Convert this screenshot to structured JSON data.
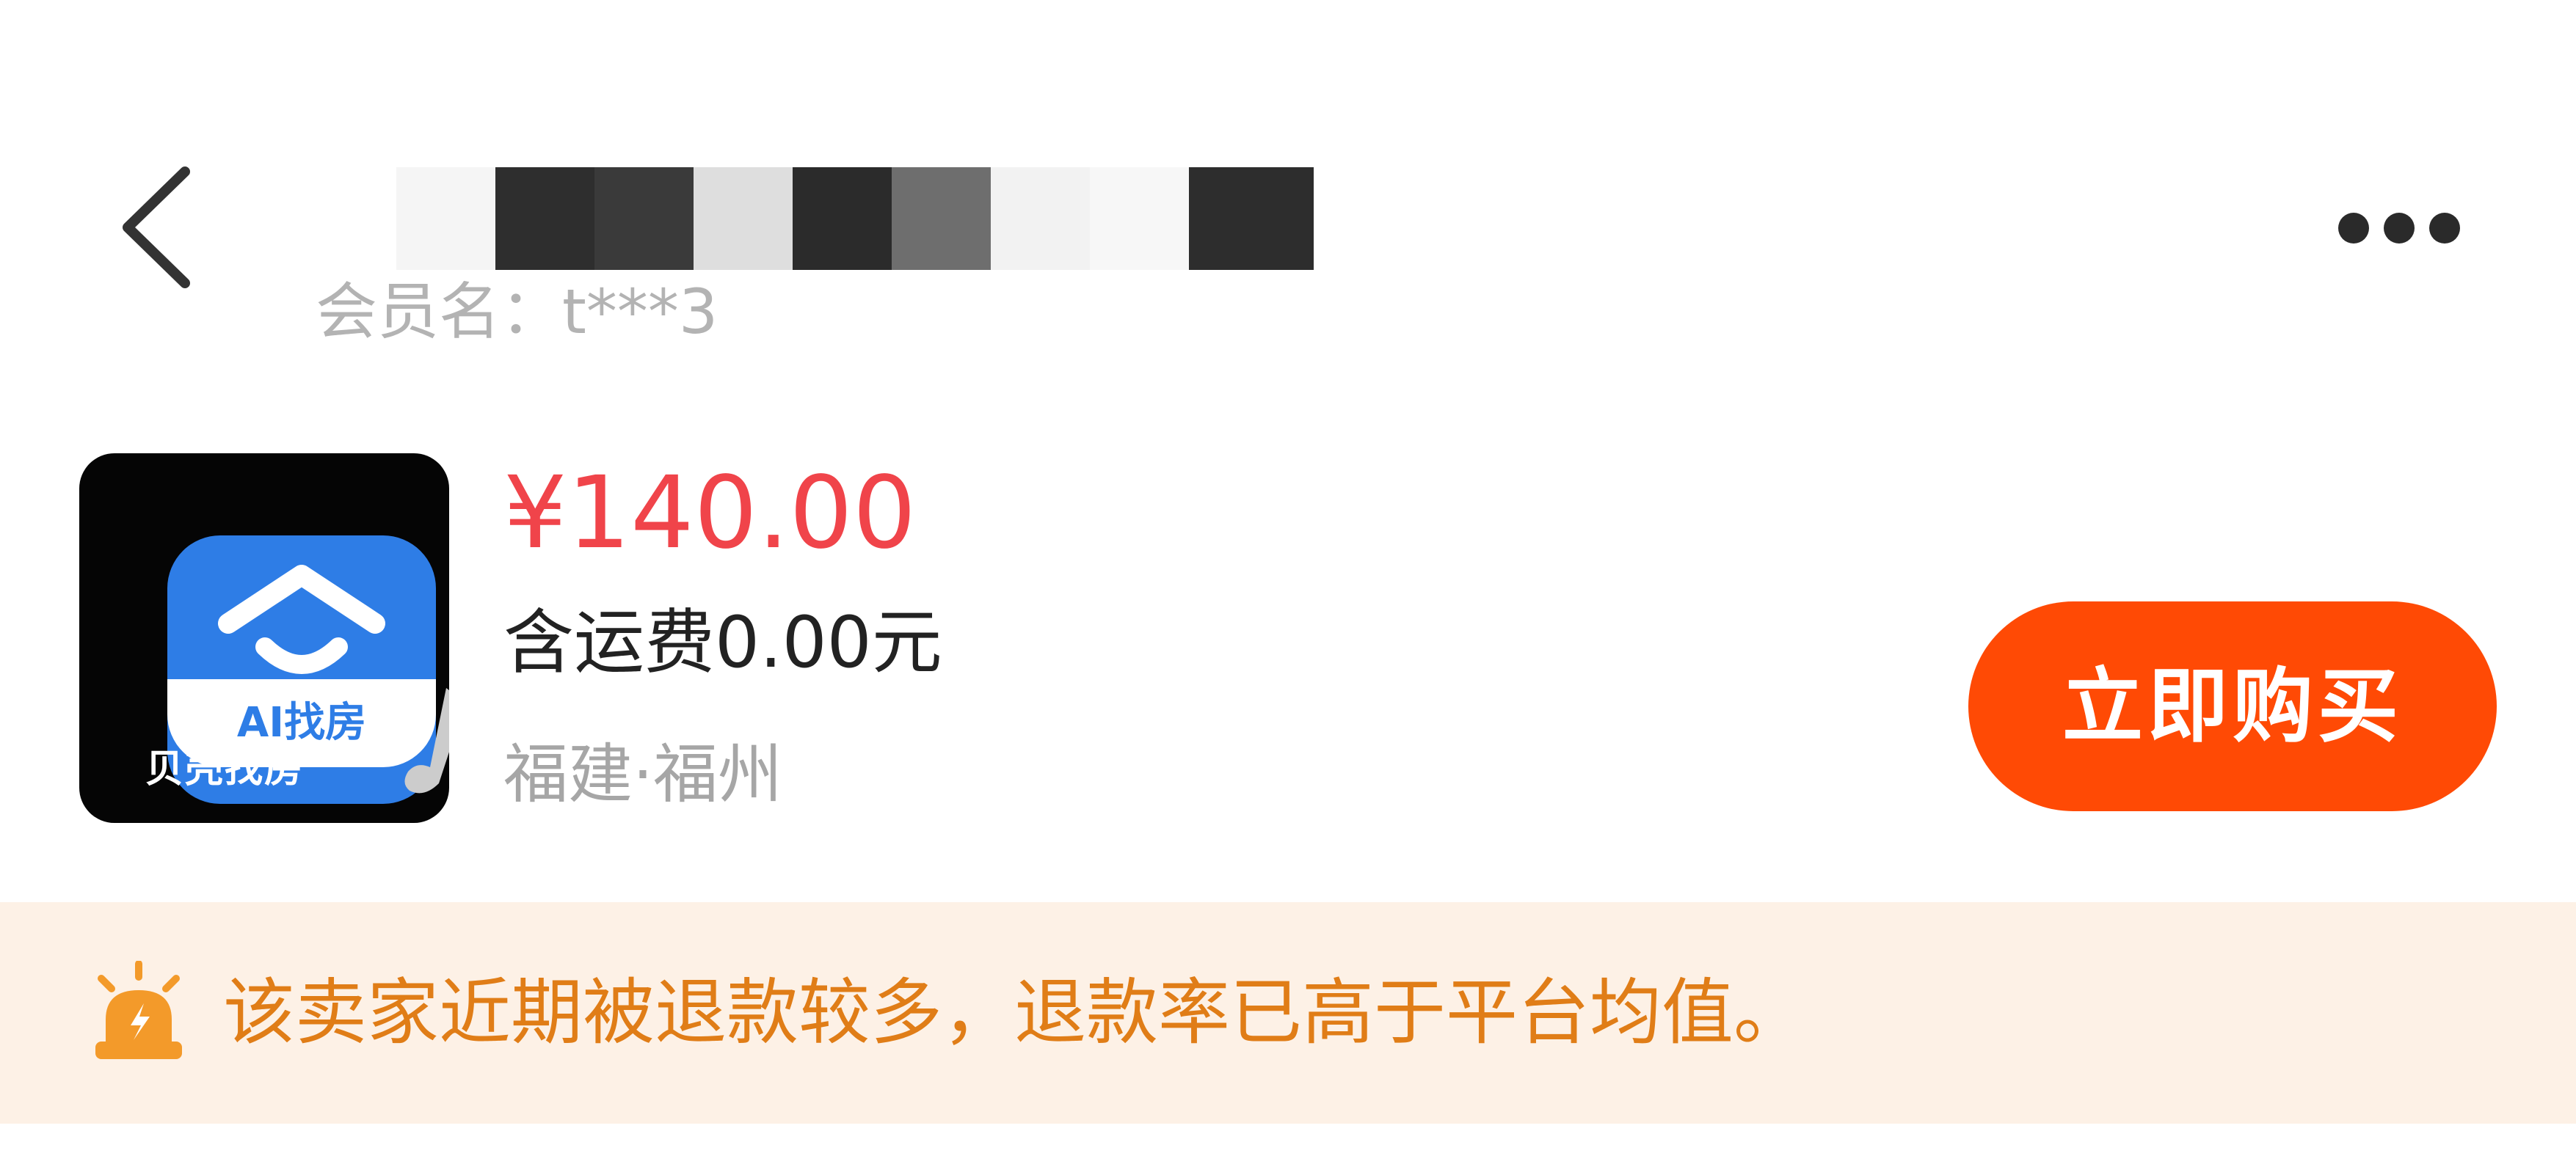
{
  "header": {
    "back_icon": "chevron-left-icon",
    "member_label": "会员名：t***3",
    "more_icon": "more-dots-icon",
    "title_redaction_colors": [
      "#f5f5f5",
      "#2e2e2e",
      "#3a3a3a",
      "#dedede",
      "#2b2b2b",
      "#6e6e6e",
      "#f2f2f2",
      "#f7f7f7",
      "#2d2d2d"
    ]
  },
  "product": {
    "thumbnail": {
      "app_label": "AI找房",
      "caption": "贝壳找房",
      "icon": "house-app-icon"
    },
    "price": "¥140.00",
    "shipping": "含运费0.00元",
    "location": "福建·福州",
    "buy_button_label": "立即购买"
  },
  "warning": {
    "icon": "alarm-icon",
    "text": "该卖家近期被退款较多，退款率已高于平台均值。"
  },
  "colors": {
    "price": "#f0444a",
    "buy_button": "#ff4a05",
    "banner_bg": "#fdf1e6",
    "banner_text": "#e07d17"
  }
}
